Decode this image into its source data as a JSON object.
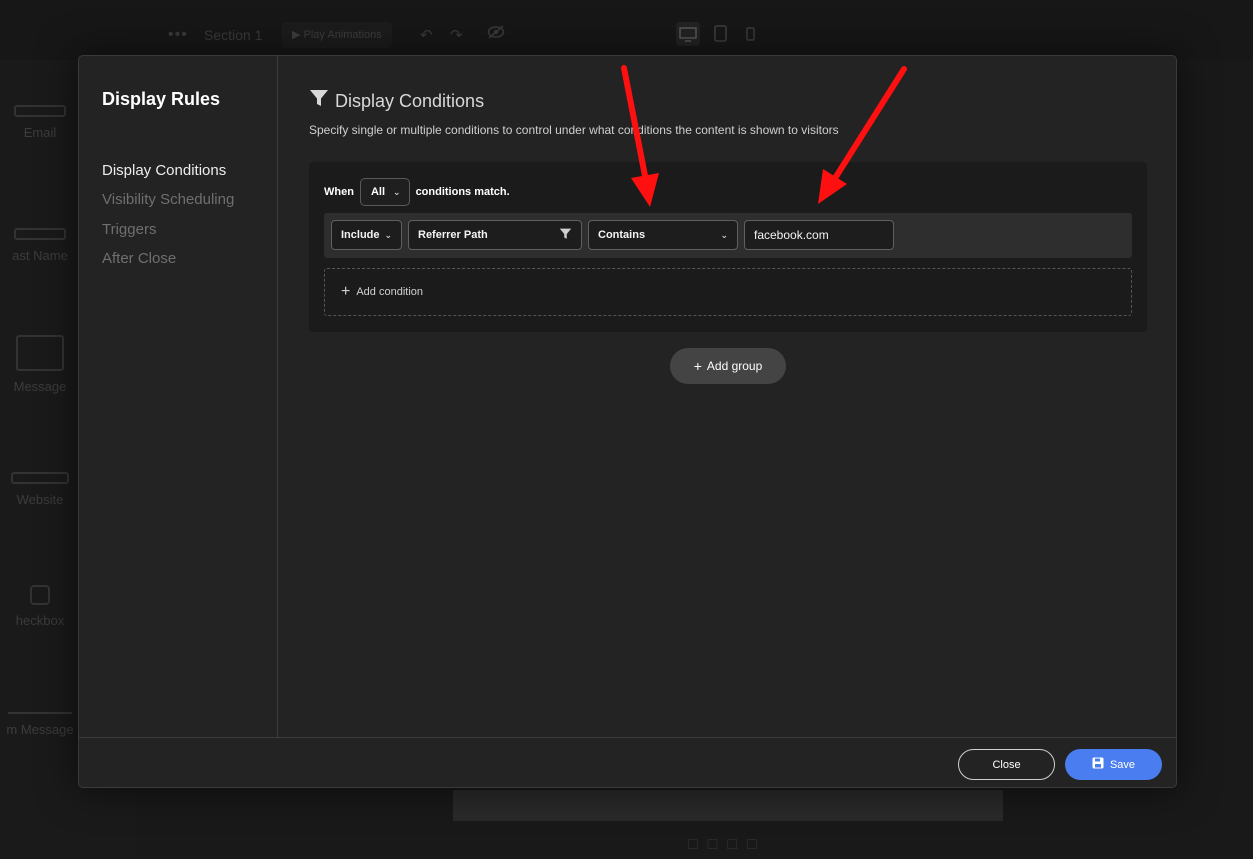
{
  "background": {
    "toolbar": {
      "section_label": "Section 1",
      "play_label": "▶ Play Animations"
    },
    "fields": [
      {
        "label": "Email"
      },
      {
        "label": "ast Name"
      },
      {
        "label": "Message"
      },
      {
        "label": "Website"
      },
      {
        "label": "heckbox"
      },
      {
        "label": "m Message"
      }
    ]
  },
  "modal": {
    "title": "Display Rules",
    "nav": [
      {
        "label": "Display Conditions",
        "active": true
      },
      {
        "label": "Visibility Scheduling",
        "active": false
      },
      {
        "label": "Triggers",
        "active": false
      },
      {
        "label": "After Close",
        "active": false
      }
    ],
    "content": {
      "title": "Display Conditions",
      "description": "Specify single or multiple conditions to control under what conditions the content is shown to visitors",
      "group": {
        "when_label": "When",
        "match_selected": "All",
        "match_suffix": "conditions match.",
        "condition": {
          "mode": "Include",
          "field": "Referrer Path",
          "operator": "Contains",
          "value": "facebook.com"
        },
        "add_condition_label": "Add condition"
      },
      "add_group_label": "Add group"
    },
    "footer": {
      "close_label": "Close",
      "save_label": "Save"
    }
  },
  "colors": {
    "accent": "#4a7df0",
    "annotation_arrow": "#ff1010"
  },
  "icons": [
    "filter-icon",
    "chevron-down-icon",
    "plus-icon",
    "save-icon",
    "annotation-arrow"
  ]
}
